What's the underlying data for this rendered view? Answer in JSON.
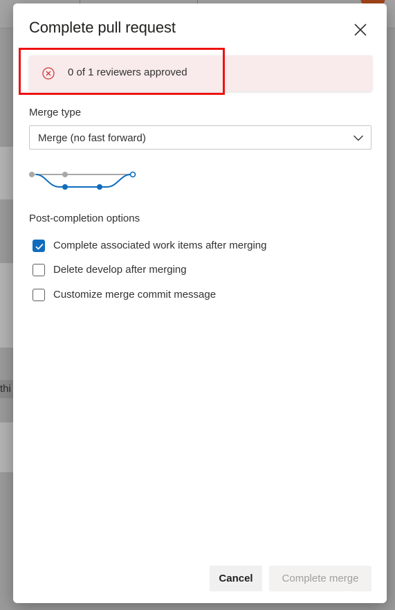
{
  "dialog": {
    "title": "Complete pull request",
    "close_icon": "close-icon"
  },
  "banner": {
    "icon": "error-circle-icon",
    "text": "0 of 1 reviewers approved",
    "background_color": "#f9ebeb",
    "icon_color": "#d13438",
    "highlight_color": "#ee1111"
  },
  "merge_type": {
    "label": "Merge type",
    "selected": "Merge (no fast forward)",
    "dropdown_icon": "chevron-down-icon",
    "diagram_icon": "merge-no-fast-forward-diagram-icon"
  },
  "post_completion": {
    "label": "Post-completion options",
    "options": [
      {
        "label": "Complete associated work items after merging",
        "checked": true
      },
      {
        "label": "Delete develop after merging",
        "checked": false
      },
      {
        "label": "Customize merge commit message",
        "checked": false
      }
    ]
  },
  "buttons": {
    "cancel": "Cancel",
    "complete": "Complete merge"
  },
  "background": {
    "partial_text": "thi",
    "avatar_color": "#a5461a"
  },
  "colors": {
    "accent": "#0f6cbd",
    "text": "#323130",
    "disabled_text": "#a19f9d"
  }
}
